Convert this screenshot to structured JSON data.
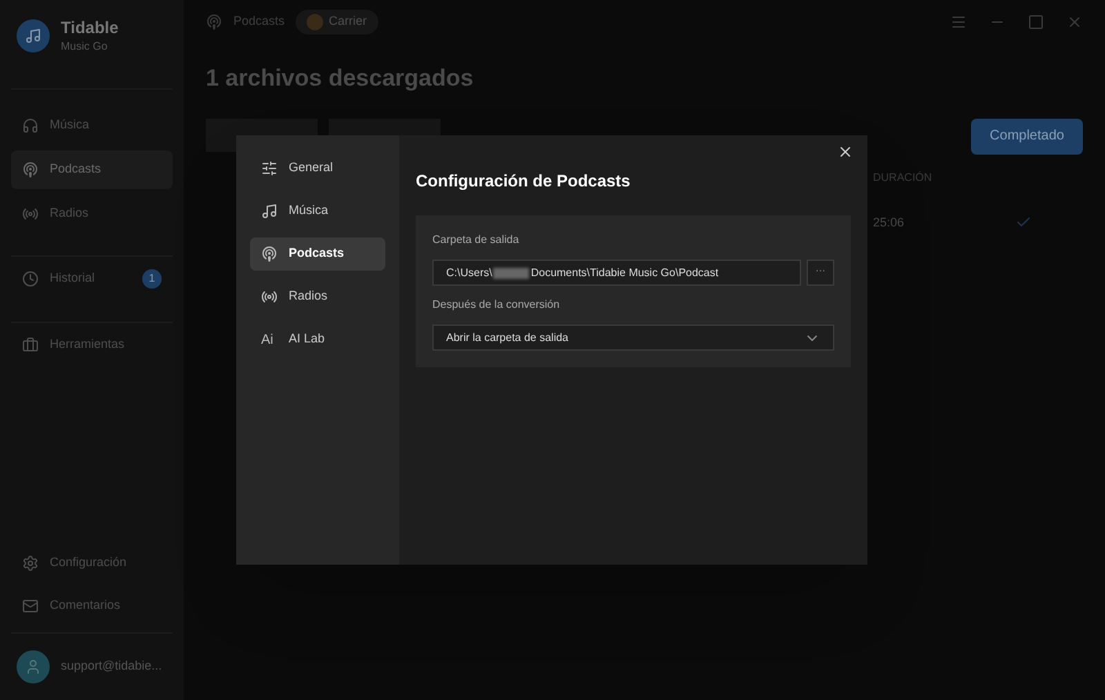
{
  "app": {
    "name": "Tidable",
    "subtitle": "Music Go"
  },
  "sidebar": {
    "items": [
      {
        "kind": "music",
        "label": "Música",
        "selected": false
      },
      {
        "kind": "podcast",
        "label": "Podcasts",
        "selected": true
      },
      {
        "kind": "radio",
        "label": "Radios",
        "selected": false
      }
    ],
    "history": {
      "label": "Historial",
      "badge": "1"
    },
    "tools": {
      "label": "Herramientas"
    },
    "bottom": [
      {
        "kind": "settings",
        "label": "Configuración"
      },
      {
        "kind": "mail",
        "label": "Comentarios"
      }
    ],
    "account": "support@tidabie..."
  },
  "breadcrumb": [
    "Podcasts",
    "Carrier"
  ],
  "title": "1 archivos descargados",
  "completed_button": "Completado",
  "table": {
    "columns": [
      "DURACIÓN"
    ],
    "rows": [
      {
        "duration": "25:06",
        "done": true
      }
    ]
  },
  "dialog": {
    "nav": [
      {
        "kind": "general",
        "label": "General",
        "selected": false
      },
      {
        "kind": "music",
        "label": "Música",
        "selected": false
      },
      {
        "kind": "podcast",
        "label": "Podcasts",
        "selected": true
      },
      {
        "kind": "radio",
        "label": "Radios",
        "selected": false
      },
      {
        "kind": "ai",
        "icon_text": "Ai",
        "label": "AI Lab",
        "selected": false
      }
    ],
    "title": "Configuración de Podcasts",
    "output_label": "Carpeta de salida",
    "path_prefix": "C:\\Users\\",
    "path_suffix": "Documents\\Tidabie Music Go\\Podcast",
    "browse": "···",
    "after_label": "Después de la conversión",
    "after_value": "Abrir la carpeta de salida"
  }
}
